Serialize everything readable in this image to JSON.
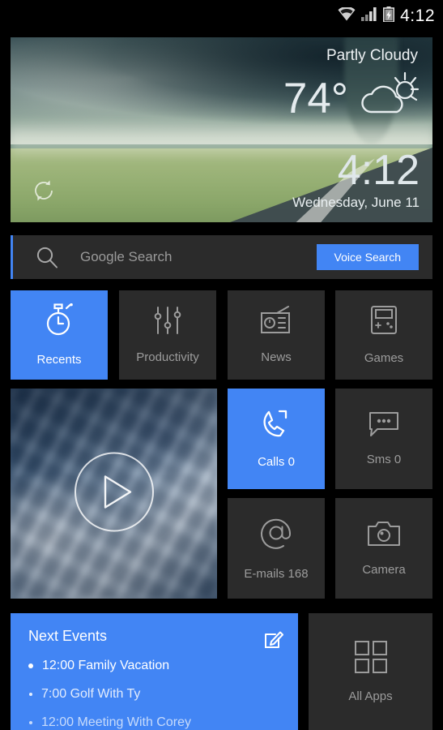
{
  "status_bar": {
    "time": "4:12",
    "icons": [
      "wifi-icon",
      "signal-icon",
      "battery-charging-icon"
    ]
  },
  "weather_widget": {
    "condition": "Partly Cloudy",
    "temperature": "74°",
    "weather_icon": "partly-cloudy-icon",
    "clock": "4:12",
    "date": "Wednesday, June 11",
    "refresh_icon": "refresh-icon",
    "background": "tornado-over-field-photo"
  },
  "search": {
    "placeholder": "Google Search",
    "icon": "search-icon",
    "voice_button": "Voice Search",
    "accent_color": "#4285f4"
  },
  "category_tiles": [
    {
      "label": "Recents",
      "icon": "stopwatch-icon",
      "active": true
    },
    {
      "label": "Productivity",
      "icon": "sliders-icon",
      "active": false
    },
    {
      "label": "News",
      "icon": "radio-icon",
      "active": false
    },
    {
      "label": "Games",
      "icon": "gamepad-icon",
      "active": false
    }
  ],
  "media_tile": {
    "icon": "play-icon",
    "background": "audio-mixer-photo"
  },
  "shortcut_tiles": [
    {
      "label": "Calls 0",
      "icon": "phone-icon",
      "active": true
    },
    {
      "label": "Sms 0",
      "icon": "sms-icon",
      "active": false
    },
    {
      "label": "E-mails 168",
      "icon": "at-icon",
      "active": false
    },
    {
      "label": "Camera",
      "icon": "camera-icon",
      "active": false
    }
  ],
  "next_events": {
    "title": "Next Events",
    "edit_icon": "edit-icon",
    "items": [
      {
        "text": "12:00 Family Vacation"
      },
      {
        "text": "7:00 Golf With Ty"
      },
      {
        "text": "12:00 Meeting With Corey"
      }
    ]
  },
  "all_apps": {
    "label": "All Apps",
    "icon": "grid-icon"
  },
  "colors": {
    "accent": "#4285f4",
    "tile": "#2b2b2b",
    "background": "#000000"
  }
}
